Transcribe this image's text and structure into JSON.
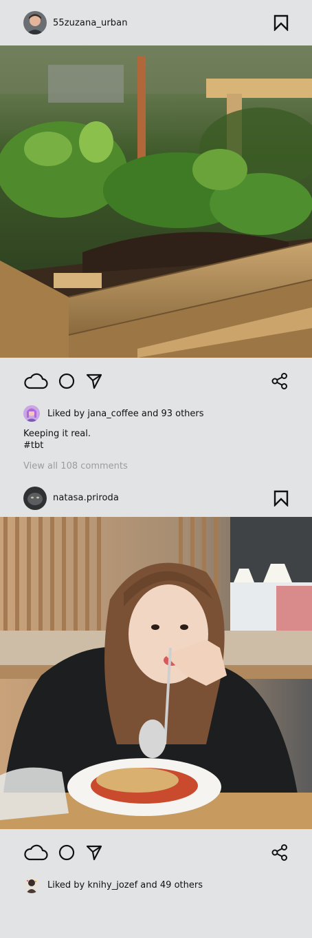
{
  "posts": [
    {
      "username": "55zuzana_urban",
      "liked_by_prefix": "Liked by ",
      "liked_by_user": "jana_coffee",
      "liked_by_suffix": " and 93 others",
      "caption_line1": "Keeping it real.",
      "caption_line2": "#tbt",
      "view_comments": "View all 108 comments",
      "photo_description_icon": "raised-garden-bed-photo"
    },
    {
      "username": "natasa.priroda",
      "liked_by_prefix": "Liked by ",
      "liked_by_user": "knihy_jozef",
      "liked_by_suffix": " and 49 others",
      "photo_description_icon": "woman-eating-spaghetti-photo"
    }
  ],
  "icons": {
    "like": "cloud-icon",
    "comment": "circle-icon",
    "send": "send-arrow-icon",
    "share": "share-icon",
    "save": "bookmark-icon"
  },
  "colors": {
    "background": "#e1e3e4",
    "muted_text": "#9a9c9e"
  }
}
